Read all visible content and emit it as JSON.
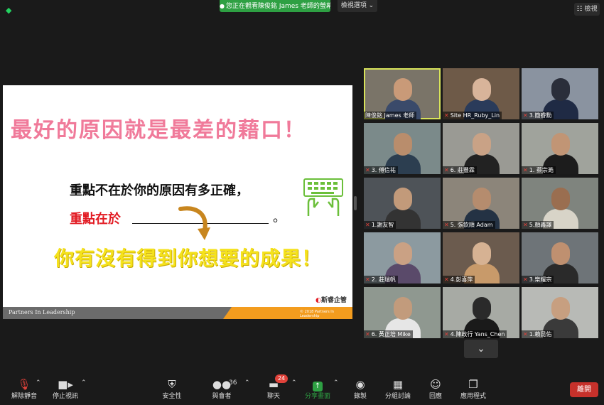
{
  "top": {
    "share_banner": "您正在觀看陳俊銘 James 老師的螢幕",
    "view_options": "檢視選項",
    "gallery_view": "檢視"
  },
  "slide": {
    "title": "最好的原因就是最差的藉口！",
    "line1": "重點不在於你的原因有多正確，",
    "line2": "重點在於",
    "period": "。",
    "line3": "你有沒有得到你想要的成果！",
    "logo_text": "斯睿企管",
    "footer_left": "Partners In Leadership",
    "footer_right": "© 2018 Partners In Leadership",
    "colors": {
      "title": "#f07a9a",
      "line2": "#e21b23",
      "line3": "#f5e21c",
      "footer_orange": "#f39c1e"
    }
  },
  "participants": [
    {
      "name": "陳俊銘 James 老師",
      "muted": false,
      "active": true,
      "bg": "#7a7468",
      "skin": "#c99a78",
      "shirt": "#3a4a6a"
    },
    {
      "name": "Site HR_Ruby_Lin",
      "muted": true,
      "active": false,
      "bg": "#6e5a48",
      "skin": "#d8b49a",
      "shirt": "#2a3b5a"
    },
    {
      "name": "3.簡睿勳",
      "muted": true,
      "active": false,
      "bg": "#8a93a0",
      "skin": "#2a2e3a",
      "shirt": "#1f2a44"
    },
    {
      "name": "3. 傅信祐",
      "muted": true,
      "active": false,
      "bg": "#7b8a8a",
      "skin": "#b98d6c",
      "shirt": "#2c3e50"
    },
    {
      "name": "6. 莊豐霖",
      "muted": true,
      "active": false,
      "bg": "#9a9a94",
      "skin": "#c9a286",
      "shirt": "#222"
    },
    {
      "name": "1. 蔡宗澔",
      "muted": true,
      "active": false,
      "bg": "#a0a39c",
      "skin": "#c19575",
      "shirt": "#1c1c1c"
    },
    {
      "name": "1.謝友智",
      "muted": true,
      "active": false,
      "bg": "#4e5358",
      "skin": "#c29a7a",
      "shirt": "#333"
    },
    {
      "name": "5. 張欽順 Adam",
      "muted": true,
      "active": false,
      "bg": "#8c857a",
      "skin": "#b58c6e",
      "shirt": "#243244"
    },
    {
      "name": "5.顏義譯",
      "muted": true,
      "active": false,
      "bg": "#7f847e",
      "skin": "#9a6e50",
      "shirt": "#d8d4c8"
    },
    {
      "name": "2. 莊瑞帆",
      "muted": true,
      "active": false,
      "bg": "#8c9aa0",
      "skin": "#caa184",
      "shirt": "#5a4a6a"
    },
    {
      "name": "4.彭喜萍",
      "muted": true,
      "active": false,
      "bg": "#6b5b4e",
      "skin": "#d6b293",
      "shirt": "#c89a6a"
    },
    {
      "name": "3.樂耀宗",
      "muted": true,
      "active": false,
      "bg": "#6e7478",
      "skin": "#bf9070",
      "shirt": "#2a2a2a"
    },
    {
      "name": "6. 黃正培 Mike",
      "muted": true,
      "active": false,
      "bg": "#8f9890",
      "skin": "#c29b7c",
      "shirt": "#e6e6e6"
    },
    {
      "name": "4.陳政行 Yans_Chen",
      "muted": true,
      "active": false,
      "bg": "#a7aaa4",
      "skin": "#2a2a2a",
      "shirt": "#1a1a1a"
    },
    {
      "name": "1.賴昆佑",
      "muted": true,
      "active": false,
      "bg": "#b8bab6",
      "skin": "#c79f80",
      "shirt": "#3a3a3a"
    }
  ],
  "toolbar": {
    "unmute": "解除靜音",
    "stop_video": "停止視訊",
    "security": "安全性",
    "participants": "與會者",
    "participants_count": "36",
    "chat": "聊天",
    "chat_badge": "24",
    "share_screen": "分享畫面",
    "record": "錄製",
    "breakout": "分組討論",
    "reactions": "回應",
    "apps": "應用程式",
    "leave": "離開"
  }
}
